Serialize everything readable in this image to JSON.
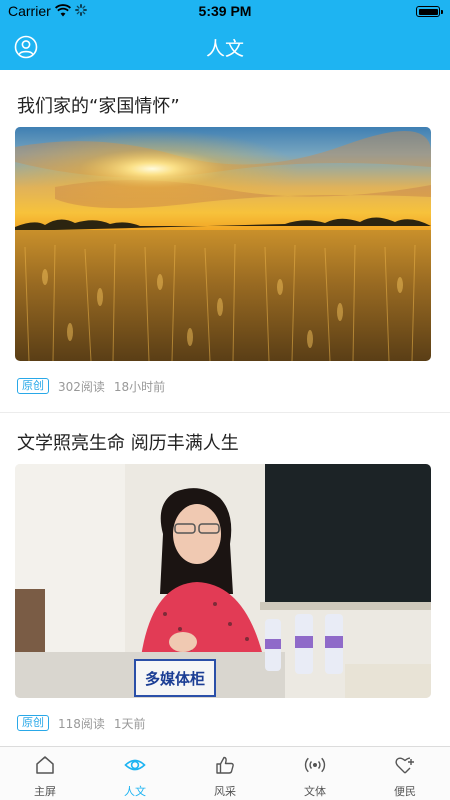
{
  "status_bar": {
    "carrier": "Carrier",
    "time": "5:39 PM"
  },
  "header": {
    "title": "人文",
    "profile_icon": "user-circle-icon"
  },
  "articles": [
    {
      "title": "我们家的“家国情怀”",
      "tag": "原创",
      "reads": "302阅读",
      "time": "18小时前",
      "image": "wheat-field-sunset-photo"
    },
    {
      "title": "文学照亮生命  阅历丰满人生",
      "tag": "原创",
      "reads": "118阅读",
      "time": "1天前",
      "image": "speaker-at-podium-photo",
      "image_text": "多媒体柜"
    }
  ],
  "tabs": [
    {
      "label": "主屏",
      "icon": "home-icon",
      "active": false
    },
    {
      "label": "人文",
      "icon": "eye-icon",
      "active": true
    },
    {
      "label": "风采",
      "icon": "thumbs-up-icon",
      "active": false
    },
    {
      "label": "文体",
      "icon": "broadcast-icon",
      "active": false
    },
    {
      "label": "便民",
      "icon": "heart-plus-icon",
      "active": false
    }
  ],
  "colors": {
    "accent": "#1eb4f2",
    "tag": "#29a8e8",
    "text": "#222222",
    "meta": "#999999"
  }
}
